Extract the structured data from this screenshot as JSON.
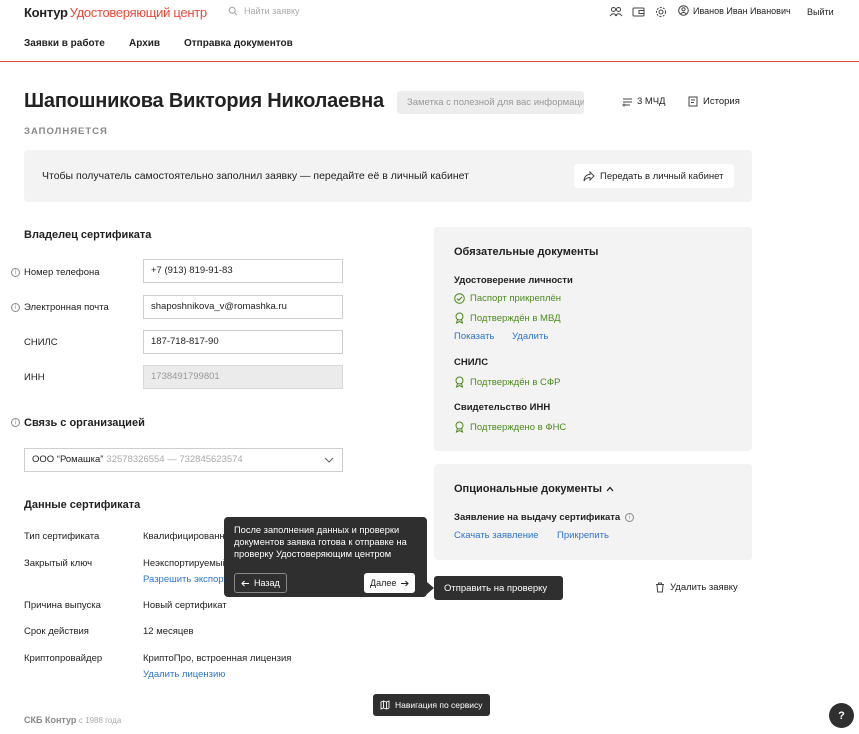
{
  "header": {
    "logo_brand": "Контур",
    "logo_product": "Удостоверяющий центр",
    "search_placeholder": "Найти заявку",
    "user_name": "Иванов Иван Иванович",
    "logout_label": "Выйти"
  },
  "nav": {
    "items": [
      "Заявки в работе",
      "Архив",
      "Отправка документов"
    ]
  },
  "page": {
    "title": "Шапошникова Виктория Николаевна",
    "note_placeholder": "Заметка с полезной для вас информацией",
    "mchd_label": "3 МЧД",
    "history_label": "История",
    "status": "ЗАПОЛНЯЕТСЯ"
  },
  "banner": {
    "text": "Чтобы получатель самостоятельно заполнил заявку — передайте её в личный кабинет",
    "button": "Передать в личный кабинет"
  },
  "owner": {
    "title": "Владелец сертификата",
    "phone_label": "Номер телефона",
    "phone_value": "+7 (913) 819-91-83",
    "email_label": "Электронная почта",
    "email_value": "shaposhnikova_v@romashka.ru",
    "snils_label": "СНИЛС",
    "snils_value": "187-718-817-90",
    "inn_label": "ИНН",
    "inn_value": "1738491799801"
  },
  "org": {
    "title": "Связь с организацией",
    "name": "ООО “Ромашка”",
    "codes": "32578326554 — 732845623574"
  },
  "cert": {
    "title": "Данные сертификата",
    "type_label": "Тип сертификата",
    "type_value": "Квалифицированный сертификат",
    "key_label": "Закрытый ключ",
    "key_value": "Неэкспортируемый",
    "key_link": "Разрешить экспорт",
    "reason_label": "Причина выпуска",
    "reason_value": "Новый сертификат",
    "term_label": "Срок действия",
    "term_value": "12 месяцев",
    "crypto_label": "Криптопровайдер",
    "crypto_value": "КриптоПро, встроенная лицензия",
    "crypto_link": "Удалить лицензию"
  },
  "required_docs": {
    "title": "Обязательные документы",
    "id_title": "Удостоверение личности",
    "id_status1": "Паспорт прикреплён",
    "id_status2": "Подтверждён в МВД",
    "show_link": "Показать",
    "delete_link": "Удалить",
    "snils_title": "СНИЛС",
    "snils_status": "Подтверждён в СФР",
    "inn_title": "Свидетельство ИНН",
    "inn_status": "Подтверждено в ФНС"
  },
  "optional_docs": {
    "title": "Опциональные документы",
    "statement_title": "Заявление на выдачу сертификата",
    "download_link": "Скачать заявление",
    "attach_link": "Прикрепить"
  },
  "actions": {
    "send_label": "Отправить на проверку",
    "delete_label": "Удалить заявку"
  },
  "tooltip": {
    "text": "После заполнения данных и проверки документов заявка готова к отправке на проверку Удостоверяющим центром",
    "back_label": "Назад",
    "next_label": "Далее"
  },
  "footer": {
    "brand": "СКБ Контур",
    "since": "с 1988 года",
    "nav_help": "Навигация по сервису",
    "help_button": "?"
  },
  "colors": {
    "brand_red": "#e84a3a",
    "link_blue": "#2e75c9",
    "ok_green": "#4d8a1e",
    "dark": "#2f2f2f"
  }
}
